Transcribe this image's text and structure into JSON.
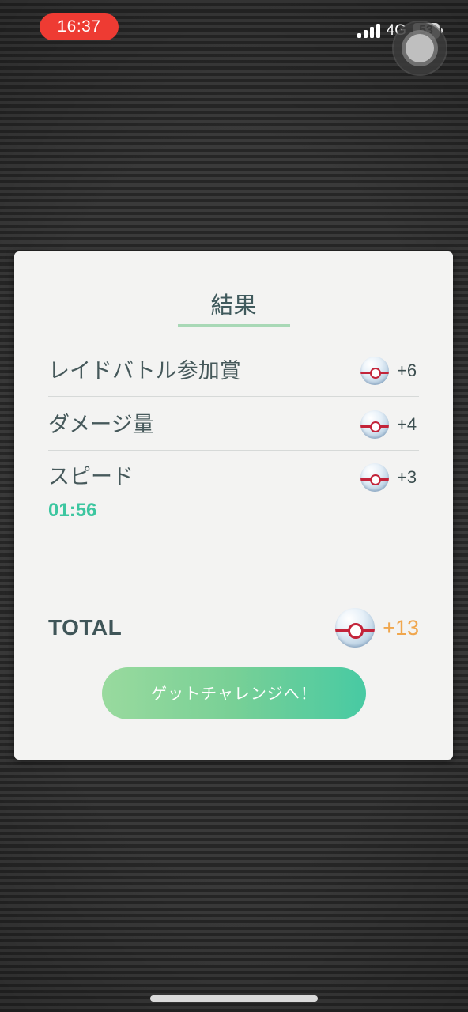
{
  "status_bar": {
    "time": "16:37",
    "network": "4G",
    "battery": "53"
  },
  "result_card": {
    "title": "結果",
    "rows": [
      {
        "label": "レイドバトル参加賞",
        "sub": "",
        "reward_icon": "premier-ball-icon",
        "reward": "+6"
      },
      {
        "label": "ダメージ量",
        "sub": "",
        "reward_icon": "premier-ball-icon",
        "reward": "+4"
      },
      {
        "label": "スピード",
        "sub": "01:56",
        "reward_icon": "premier-ball-icon",
        "reward": "+3"
      }
    ],
    "total_label": "TOTAL",
    "total_reward": "+13",
    "button_label": "ゲットチャレンジへ！"
  },
  "colors": {
    "accent_green": "#3cc6a0",
    "total_orange": "#f0a64d",
    "time_pill_red": "#ee3b33"
  }
}
